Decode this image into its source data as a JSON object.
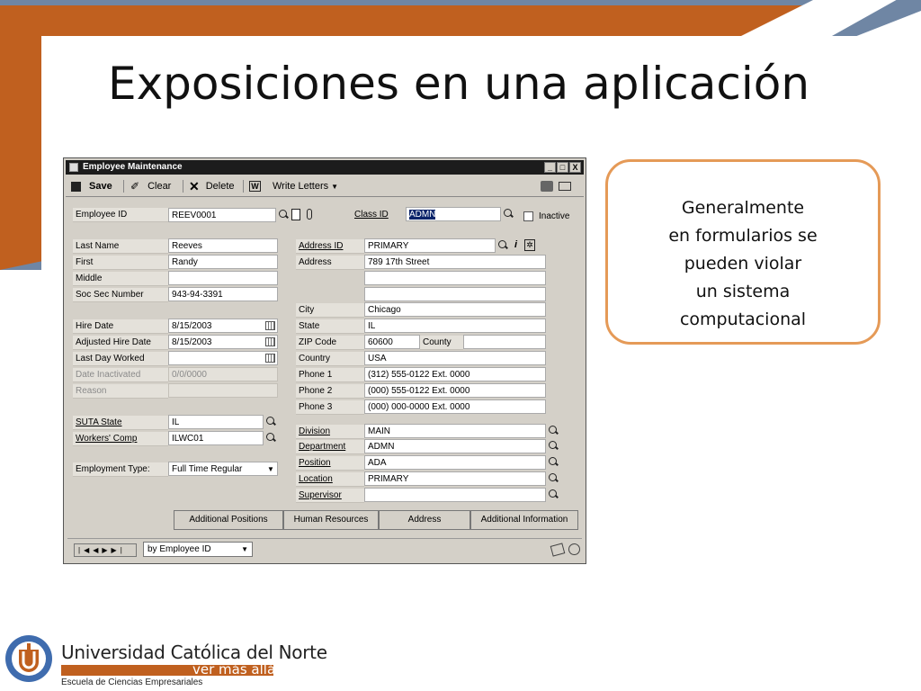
{
  "slide": {
    "title": "Exposiciones en una aplicación",
    "callout": [
      "Generalmente",
      "en formularios se",
      "pueden violar",
      "un sistema",
      "computacional"
    ]
  },
  "window": {
    "title": "Employee Maintenance",
    "controls": [
      "_",
      "□",
      "X"
    ],
    "toolbar": {
      "save": "Save",
      "clear": "Clear",
      "delete": "Delete",
      "write_letters": "Write Letters"
    },
    "header": {
      "employee_id_label": "Employee ID",
      "employee_id": "REEV0001",
      "class_id_label": "Class ID",
      "class_id": "ADMN",
      "inactive_label": "Inactive"
    },
    "name": {
      "last_label": "Last Name",
      "last": "Reeves",
      "first_label": "First",
      "first": "Randy",
      "middle_label": "Middle",
      "middle": "",
      "ssn_label": "Soc Sec Number",
      "ssn": "943-94-3391"
    },
    "dates": {
      "hire_label": "Hire Date",
      "hire": "8/15/2003",
      "adj_hire_label": "Adjusted Hire Date",
      "adj_hire": "8/15/2003",
      "last_day_label": "Last Day Worked",
      "last_day": "",
      "inactivated_label": "Date Inactivated",
      "inactivated": "0/0/0000",
      "reason_label": "Reason",
      "reason": ""
    },
    "suta": {
      "state_label": "SUTA State",
      "state": "IL",
      "comp_label": "Workers' Comp",
      "comp": "ILWC01"
    },
    "employment": {
      "type_label": "Employment Type:",
      "type": "Full Time Regular"
    },
    "address": {
      "id_label": "Address ID",
      "id": "PRIMARY",
      "address_label": "Address",
      "line1": "789 17th Street",
      "line2": "",
      "line3": "",
      "city_label": "City",
      "city": "Chicago",
      "state_label": "State",
      "state": "IL",
      "zip_label": "ZIP Code",
      "zip": "60600",
      "county_label": "County",
      "country_label": "Country",
      "country": "USA",
      "phone1_label": "Phone 1",
      "phone1": "(312) 555-0122  Ext. 0000",
      "phone2_label": "Phone 2",
      "phone2": "(000) 555-0122  Ext. 0000",
      "phone3_label": "Phone 3",
      "phone3": "(000) 000-0000  Ext. 0000"
    },
    "org": {
      "division_label": "Division",
      "division": "MAIN",
      "department_label": "Department",
      "department": "ADMN",
      "position_label": "Position",
      "position": "ADA",
      "location_label": "Location",
      "location": "PRIMARY",
      "supervisor_label": "Supervisor",
      "supervisor": ""
    },
    "buttons": [
      "Additional Positions",
      "Human Resources",
      "Address",
      "Additional Information"
    ],
    "status": {
      "sort": "by Employee ID"
    }
  },
  "footer": {
    "university": "Universidad Católica del Norte",
    "tagline": "ver más allá",
    "school": "Escuela de Ciencias Empresariales"
  }
}
